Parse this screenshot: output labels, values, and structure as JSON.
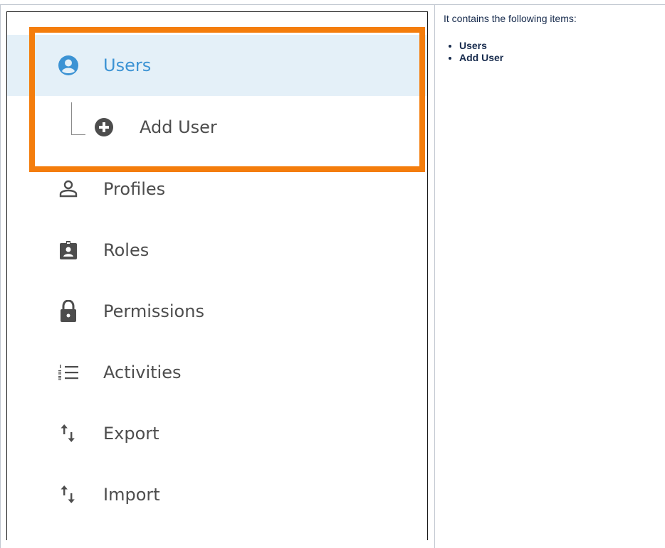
{
  "description": {
    "intro": "It  contains the following items:",
    "items": [
      "Users",
      "Add User"
    ]
  },
  "menu": {
    "items": [
      {
        "label": "Users",
        "icon": "account-circle-icon",
        "state": "active"
      },
      {
        "label": "Add User",
        "icon": "add-circle-icon",
        "state": "sub-item"
      },
      {
        "label": "Profiles",
        "icon": "person-outline-icon"
      },
      {
        "label": "Roles",
        "icon": "badge-icon"
      },
      {
        "label": "Permissions",
        "icon": "lock-icon"
      },
      {
        "label": "Activities",
        "icon": "numbered-list-icon"
      },
      {
        "label": "Export",
        "icon": "swap-vertical-icon"
      },
      {
        "label": "Import",
        "icon": "swap-vertical-icon"
      }
    ]
  },
  "colors": {
    "highlight": "#f47d0c",
    "active_bg": "#e4f0f8",
    "active_text": "#3c93d4",
    "icon": "#4d4d4d"
  }
}
